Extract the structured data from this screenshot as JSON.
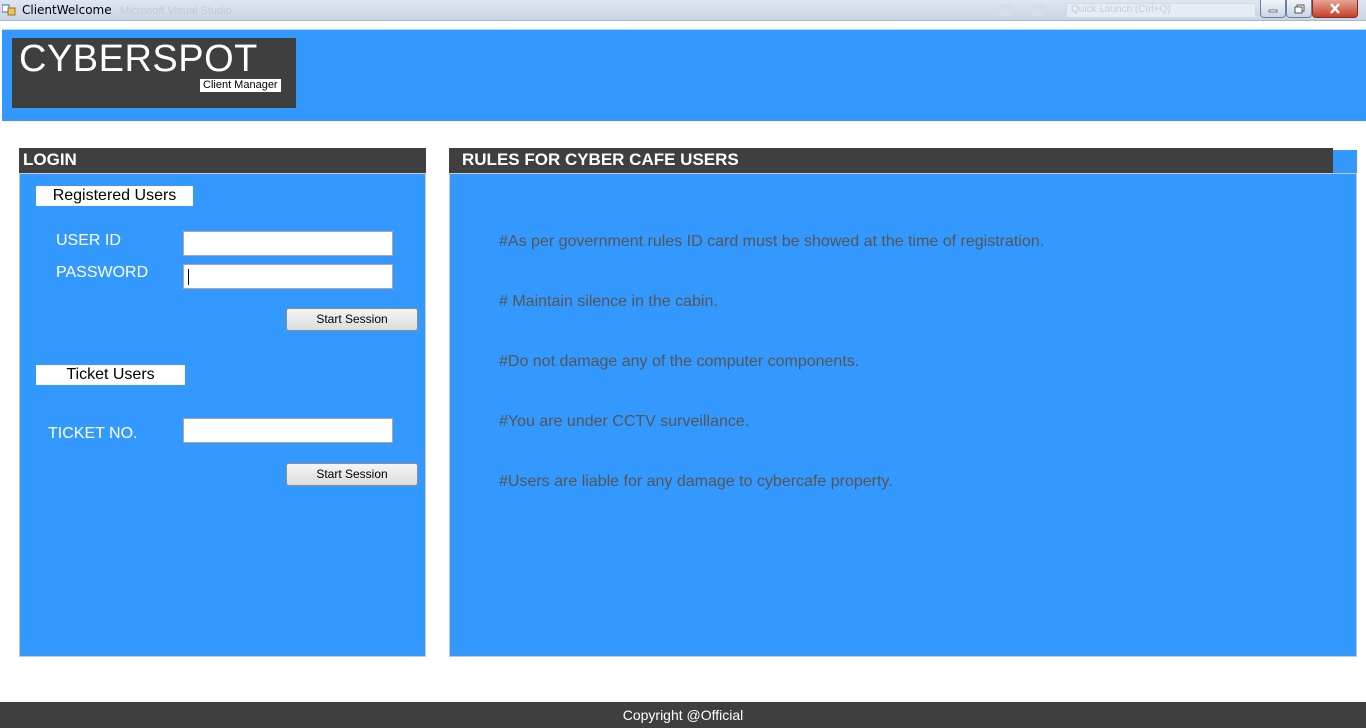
{
  "window": {
    "title": "ClientWelcome",
    "background_title": "Microsoft Visual Studio",
    "quick_launch_placeholder": "Quick Launch (Ctrl+Q)"
  },
  "header": {
    "brand": "CYBERSPOT",
    "subtitle": "Client Manager",
    "color": "#3399ff"
  },
  "login": {
    "heading": "LOGIN",
    "registered": {
      "section_label": "Registered Users",
      "user_id_label": "USER ID",
      "user_id_value": "",
      "password_label": "PASSWORD",
      "password_value": "",
      "button_label": "Start Session"
    },
    "ticket": {
      "section_label": "Ticket Users",
      "ticket_label": "TICKET NO.",
      "ticket_value": "",
      "button_label": "Start Session"
    }
  },
  "rules": {
    "heading": "RULES FOR CYBER CAFE USERS",
    "items": [
      "#As per government rules ID card must be showed at the time of registration.",
      "# Maintain silence in the cabin.",
      "#Do not damage any of the computer components.",
      "#You are under CCTV surveillance.",
      "#Users are liable for any damage to cybercafe property."
    ]
  },
  "footer": {
    "text": "Copyright  @Official"
  },
  "icons": {
    "app": "app-window-icon",
    "minimize": "minimize-icon",
    "maximize": "maximize-icon",
    "close": "close-icon"
  }
}
